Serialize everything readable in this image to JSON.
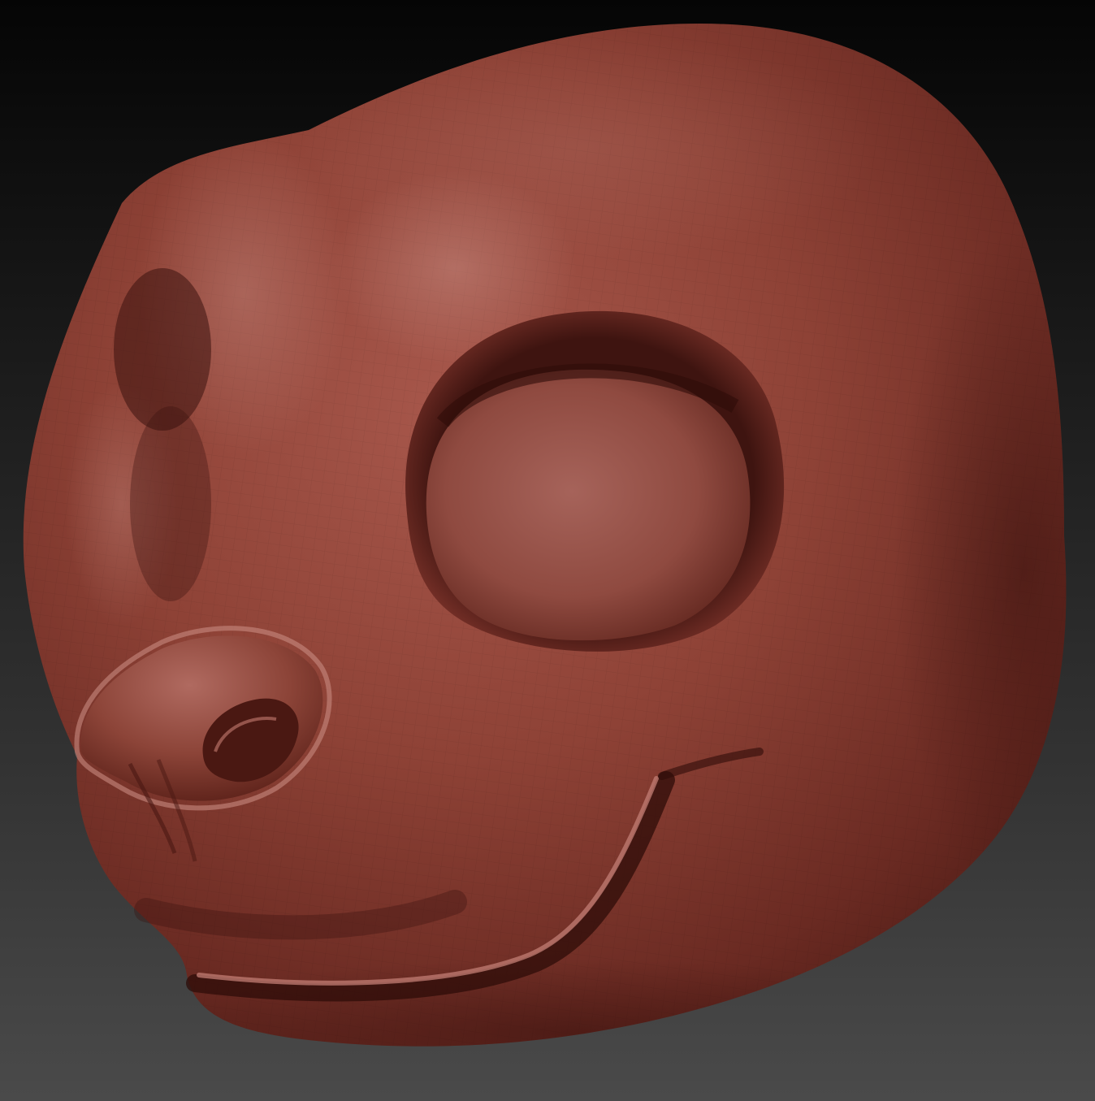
{
  "viewport": {
    "background_top": "#050505",
    "background_bottom": "#4a4a4a"
  },
  "model": {
    "material_color": "#9a4a3e",
    "highlight_color": "#c88a80",
    "shadow_color": "#4a1a14",
    "wireframe_visible": true
  },
  "icons": {
    "viewport": "3d-viewport",
    "model": "sculpt-mesh"
  }
}
